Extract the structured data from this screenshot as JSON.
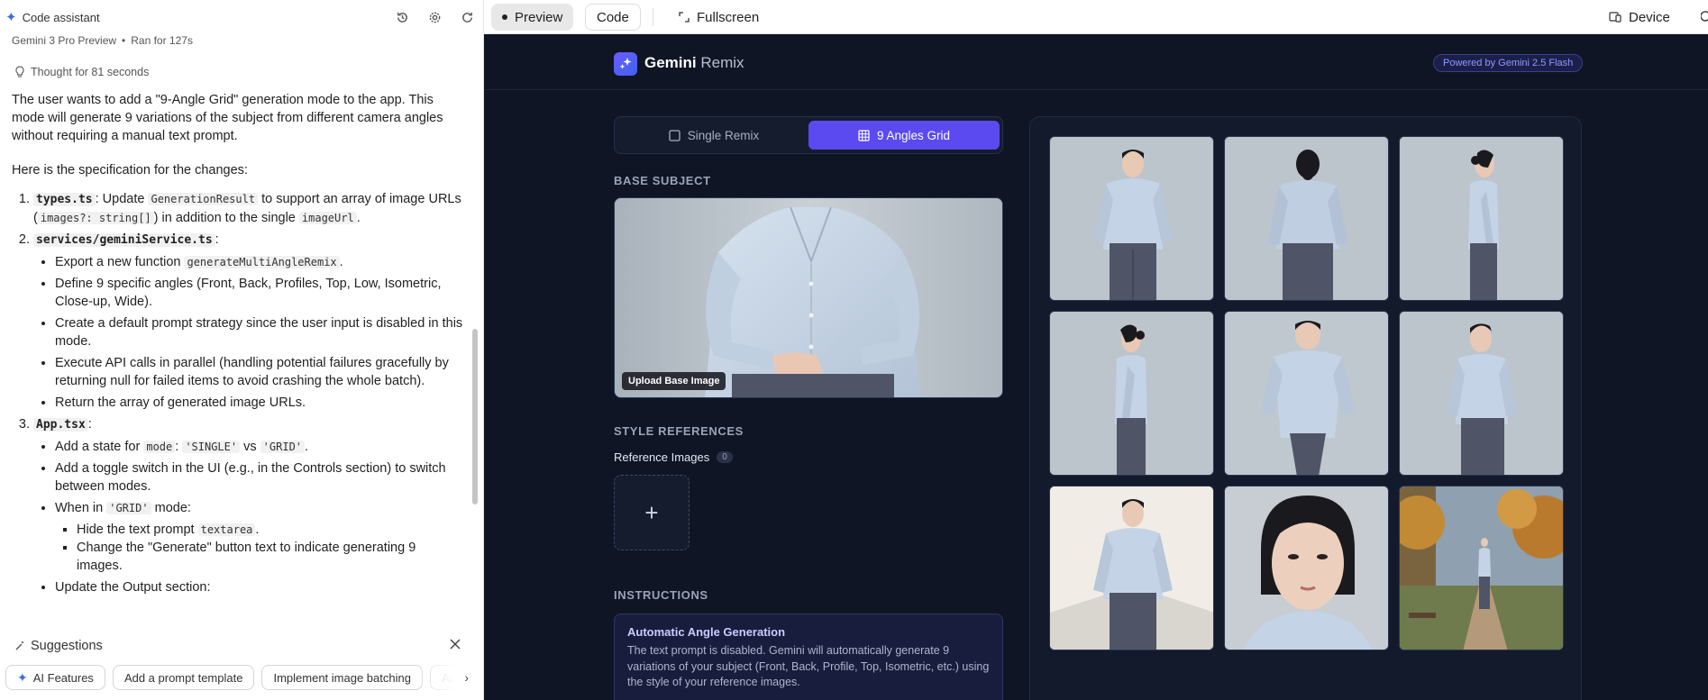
{
  "left_panel": {
    "title": "Code assistant",
    "model": "Gemini 3 Pro Preview",
    "ran_for": "Ran for 127s",
    "thought": "Thought for 81 seconds",
    "intro": "The user wants to add a \"9-Angle Grid\" generation mode to the app. This mode will generate 9 variations of the subject from different camera angles without requiring a manual text prompt.",
    "spec_intro": "Here is the specification for the changes:",
    "items": {
      "i1_file": "types.ts",
      "i1_a": ": Update ",
      "i1_code1": "GenerationResult",
      "i1_b": " to support an array of image URLs (",
      "i1_code2": "images?: string[]",
      "i1_c": ") in addition to the single ",
      "i1_code3": "imageUrl",
      "i1_d": ".",
      "i2_file": "services/geminiService.ts",
      "i2_colon": ":",
      "i2_s1_a": "Export a new function ",
      "i2_s1_code": "generateMultiAngleRemix",
      "i2_s1_b": ".",
      "i2_s2": "Define 9 specific angles (Front, Back, Profiles, Top, Low, Isometric, Close-up, Wide).",
      "i2_s3": "Create a default prompt strategy since the user input is disabled in this mode.",
      "i2_s4": "Execute API calls in parallel (handling potential failures gracefully by returning null for failed items to avoid crashing the whole batch).",
      "i2_s5": "Return the array of generated image URLs.",
      "i3_file": "App.tsx",
      "i3_colon": ":",
      "i3_s1_a": "Add a state for ",
      "i3_s1_code1": "mode",
      "i3_s1_b": ": ",
      "i3_s1_code2": "'SINGLE'",
      "i3_s1_c": " vs ",
      "i3_s1_code3": "'GRID'",
      "i3_s1_d": ".",
      "i3_s2": "Add a toggle switch in the UI (e.g., in the Controls section) to switch between modes.",
      "i3_s3_a": "When in ",
      "i3_s3_code": "'GRID'",
      "i3_s3_b": " mode:",
      "i3_s3_1_a": "Hide the text prompt ",
      "i3_s3_1_code": "textarea",
      "i3_s3_1_b": ".",
      "i3_s3_2": "Change the \"Generate\" button text to indicate generating 9 images.",
      "i3_s4": "Update the Output section:"
    },
    "suggestions_title": "Suggestions",
    "chips": [
      "AI Features",
      "Add a prompt template",
      "Implement image batching",
      "Ad"
    ]
  },
  "toolbar": {
    "preview": "Preview",
    "code": "Code",
    "fullscreen": "Fullscreen",
    "device": "Device"
  },
  "app": {
    "brand_bold": "Gemini",
    "brand_light": "Remix",
    "powered": "Powered by Gemini 2.5 Flash",
    "mode_single": "Single Remix",
    "mode_grid": "9 Angles Grid",
    "base_subject": "BASE SUBJECT",
    "upload_badge": "Upload Base Image",
    "style_refs": "STYLE REFERENCES",
    "ref_images": "Reference Images",
    "ref_count": "0",
    "add_symbol": "+",
    "instructions": "INSTRUCTIONS",
    "instr_title": "Automatic Angle Generation",
    "instr_text": "The text prompt is disabled. Gemini will automatically generate 9 variations of your subject (Front, Back, Profile, Top, Isometric, etc.) using the style of your reference images."
  },
  "colors": {
    "accent": "#5b4af0",
    "app_bg": "#0f1524",
    "panel_bg": "#121a2c",
    "shirt": "#c5d3e6",
    "pants": "#4f5566",
    "hair": "#1a1a1e"
  }
}
